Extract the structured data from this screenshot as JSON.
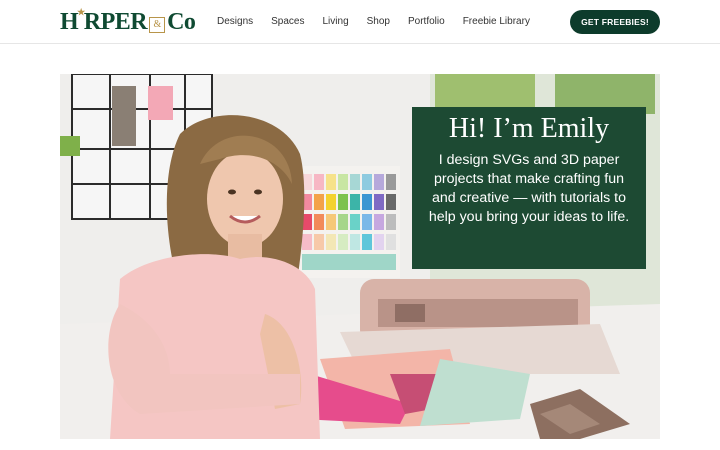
{
  "brand": {
    "logo_part1": "H",
    "logo_part2": "RPER",
    "logo_amp": "&",
    "logo_part3": "Co",
    "primary_color": "#0d3b2b",
    "accent_color": "#b8954a"
  },
  "nav": {
    "items": [
      {
        "label": "Designs"
      },
      {
        "label": "Spaces"
      },
      {
        "label": "Living"
      },
      {
        "label": "Shop"
      },
      {
        "label": "Portfolio"
      },
      {
        "label": "Freebie Library"
      }
    ],
    "cta_label": "GET FREEBIES!"
  },
  "hero": {
    "heading": "Hi! I’m Emily",
    "body": "I design SVGs and 3D paper projects that make crafting fun and creative — with tutorials to help you bring your ideas to life.",
    "box_color": "#1d4a33"
  }
}
